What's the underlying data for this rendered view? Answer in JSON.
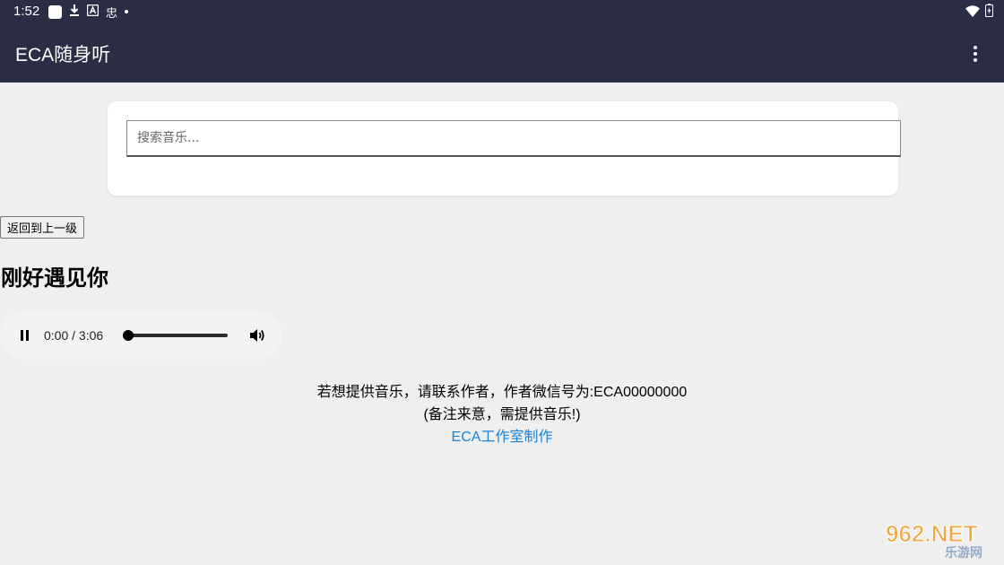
{
  "status_bar": {
    "time": "1:52",
    "icons_left": [
      "app-notification-icon",
      "download-icon",
      "a-icon",
      "bug-icon",
      "dot-icon"
    ],
    "bug_glyph": "忠",
    "icons_right": [
      "wifi-icon",
      "battery-icon"
    ]
  },
  "app_bar": {
    "title": "ECA随身听",
    "menu_icon": "more-vert-icon"
  },
  "search": {
    "placeholder": "搜索音乐..."
  },
  "back_button": {
    "label": "返回到上一级"
  },
  "song": {
    "title": "刚好遇见你"
  },
  "player": {
    "state": "playing",
    "current_time": "0:00",
    "duration": "3:06",
    "time_text": "0:00 / 3:06",
    "progress": 0
  },
  "footer": {
    "line1": "若想提供音乐，请联系作者，作者微信号为:ECA00000000",
    "line2": "(备注来意，需提供音乐!)",
    "link": "ECA工作室制作"
  },
  "watermark": {
    "brand": "962.NET",
    "subtitle": "乐游网"
  },
  "colors": {
    "app_bar": "#2b2d45",
    "background": "#efefef",
    "link": "#1a82d6"
  }
}
